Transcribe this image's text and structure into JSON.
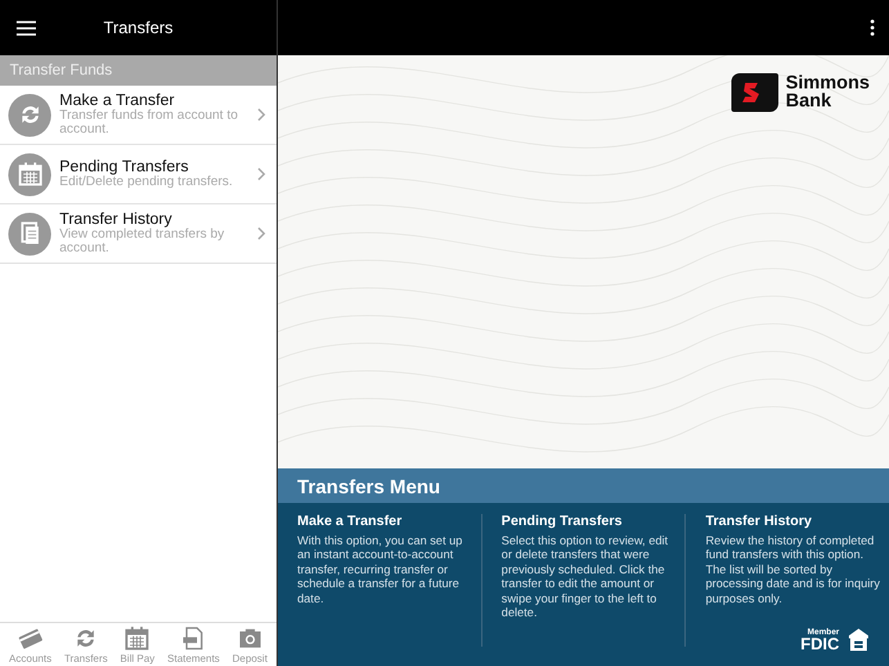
{
  "sidebar": {
    "title": "Transfers",
    "section": "Transfer Funds",
    "items": [
      {
        "kind": "sync",
        "title": "Make a Transfer",
        "subtitle": "Transfer funds from account to account."
      },
      {
        "kind": "calendar",
        "title": "Pending Transfers",
        "subtitle": "Edit/Delete pending transfers."
      },
      {
        "kind": "document",
        "title": "Transfer History",
        "subtitle": "View completed transfers by account."
      }
    ]
  },
  "tab_bar": [
    {
      "kind": "card",
      "label": "Accounts"
    },
    {
      "kind": "sync",
      "label": "Transfers"
    },
    {
      "kind": "calendar",
      "label": "Bill Pay"
    },
    {
      "kind": "pdf",
      "label": "Statements"
    },
    {
      "kind": "camera",
      "label": "Deposit"
    }
  ],
  "logo": {
    "line_1": "Simmons",
    "line_2": "Bank"
  },
  "info_panel": {
    "title": "Transfers Menu",
    "columns": [
      {
        "heading": "Make a Transfer",
        "text": "With this option, you can set up an instant account-to-account transfer, recurring transfer or schedule a transfer for a future date."
      },
      {
        "heading": "Pending Transfers",
        "text": "Select this option to review, edit or delete transfers that were previously scheduled. Click the transfer to edit the amount or swipe your finger to the left to delete."
      },
      {
        "heading": "Transfer History",
        "text": "Review the history of completed fund transfers with this option. The list will be sorted by processing date and is for inquiry purposes only."
      }
    ],
    "fdic": {
      "member": "Member",
      "name": "FDIC"
    }
  }
}
